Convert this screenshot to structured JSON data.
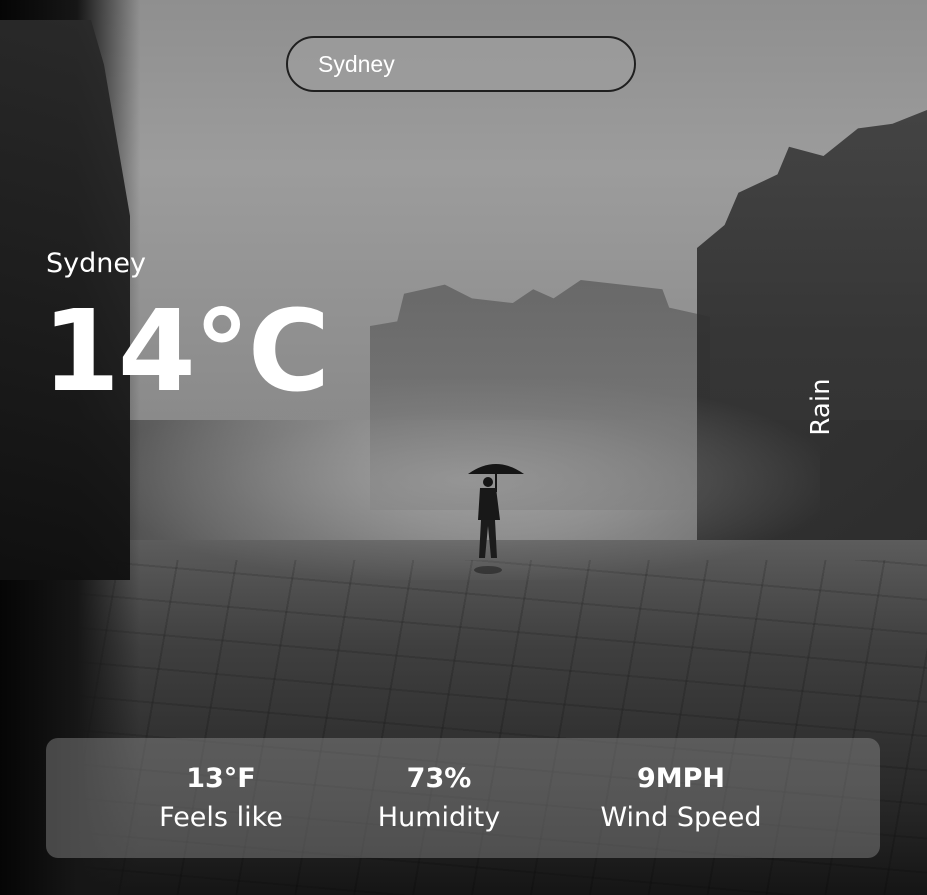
{
  "search": {
    "value": "Sydney",
    "placeholder": ""
  },
  "weather": {
    "city": "Sydney",
    "temperature": "14°C",
    "condition": "Rain"
  },
  "stats": {
    "feels_like": {
      "value": "13°F",
      "label": "Feels like"
    },
    "humidity": {
      "value": "73%",
      "label": "Humidity"
    },
    "wind": {
      "value": "9MPH",
      "label": "Wind Speed"
    }
  },
  "background": {
    "icon": "rainy-city-street-photo"
  }
}
